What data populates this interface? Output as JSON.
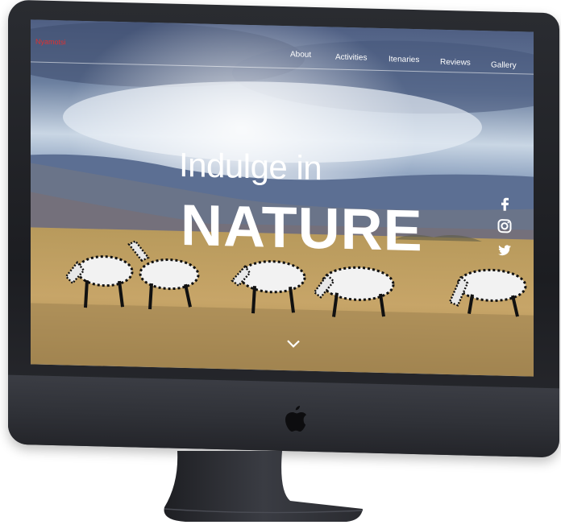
{
  "site": {
    "brand": "Nyamotsi",
    "nav": [
      {
        "label": "About"
      },
      {
        "label": "Activities"
      },
      {
        "label": "Itenaries"
      },
      {
        "label": "Reviews"
      },
      {
        "label": "Gallery"
      }
    ],
    "hero": {
      "line1": "Indulge in",
      "line2": "NATURE"
    },
    "social_icons": [
      "facebook-icon",
      "instagram-icon",
      "twitter-icon"
    ],
    "scroll_icon": "chevron-down-icon"
  },
  "colors": {
    "brand_text": "#e03030",
    "nav_text": "#ffffff",
    "device_body": "#2a2c31"
  }
}
